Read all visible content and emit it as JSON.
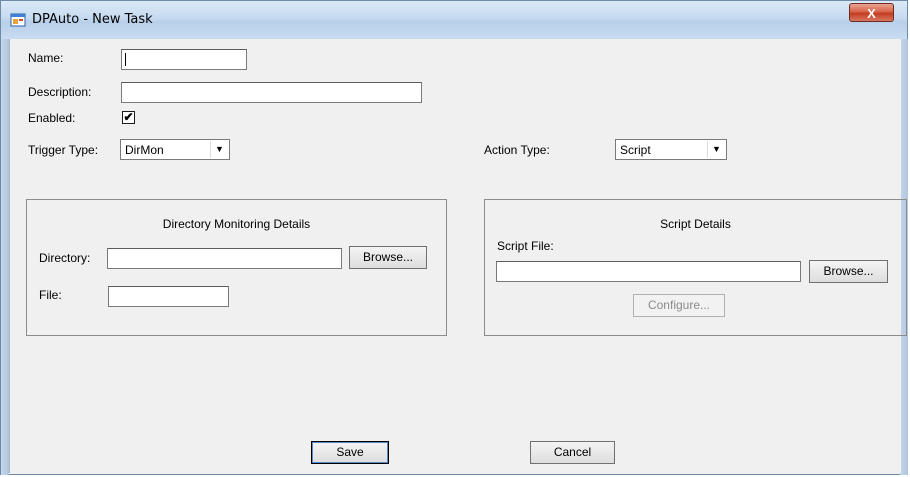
{
  "window": {
    "title": "DPAuto - New Task",
    "close_label": "X"
  },
  "form": {
    "name_label": "Name:",
    "name_value": "",
    "description_label": "Description:",
    "description_value": "",
    "enabled_label": "Enabled:",
    "enabled_checked": true,
    "enabled_mark": "✔",
    "trigger_type_label": "Trigger Type:",
    "trigger_type_value": "DirMon",
    "action_type_label": "Action Type:",
    "action_type_value": "Script"
  },
  "directory_group": {
    "title": "Directory Monitoring Details",
    "directory_label": "Directory:",
    "directory_value": "",
    "browse_label": "Browse...",
    "file_label": "File:",
    "file_value": ""
  },
  "script_group": {
    "title": "Script Details",
    "script_file_label": "Script File:",
    "script_file_value": "",
    "browse_label": "Browse...",
    "configure_label": "Configure..."
  },
  "buttons": {
    "save_label": "Save",
    "cancel_label": "Cancel"
  },
  "icons": {
    "app": "app-window-icon",
    "close": "close-icon",
    "dropdown": "chevron-down-icon"
  }
}
